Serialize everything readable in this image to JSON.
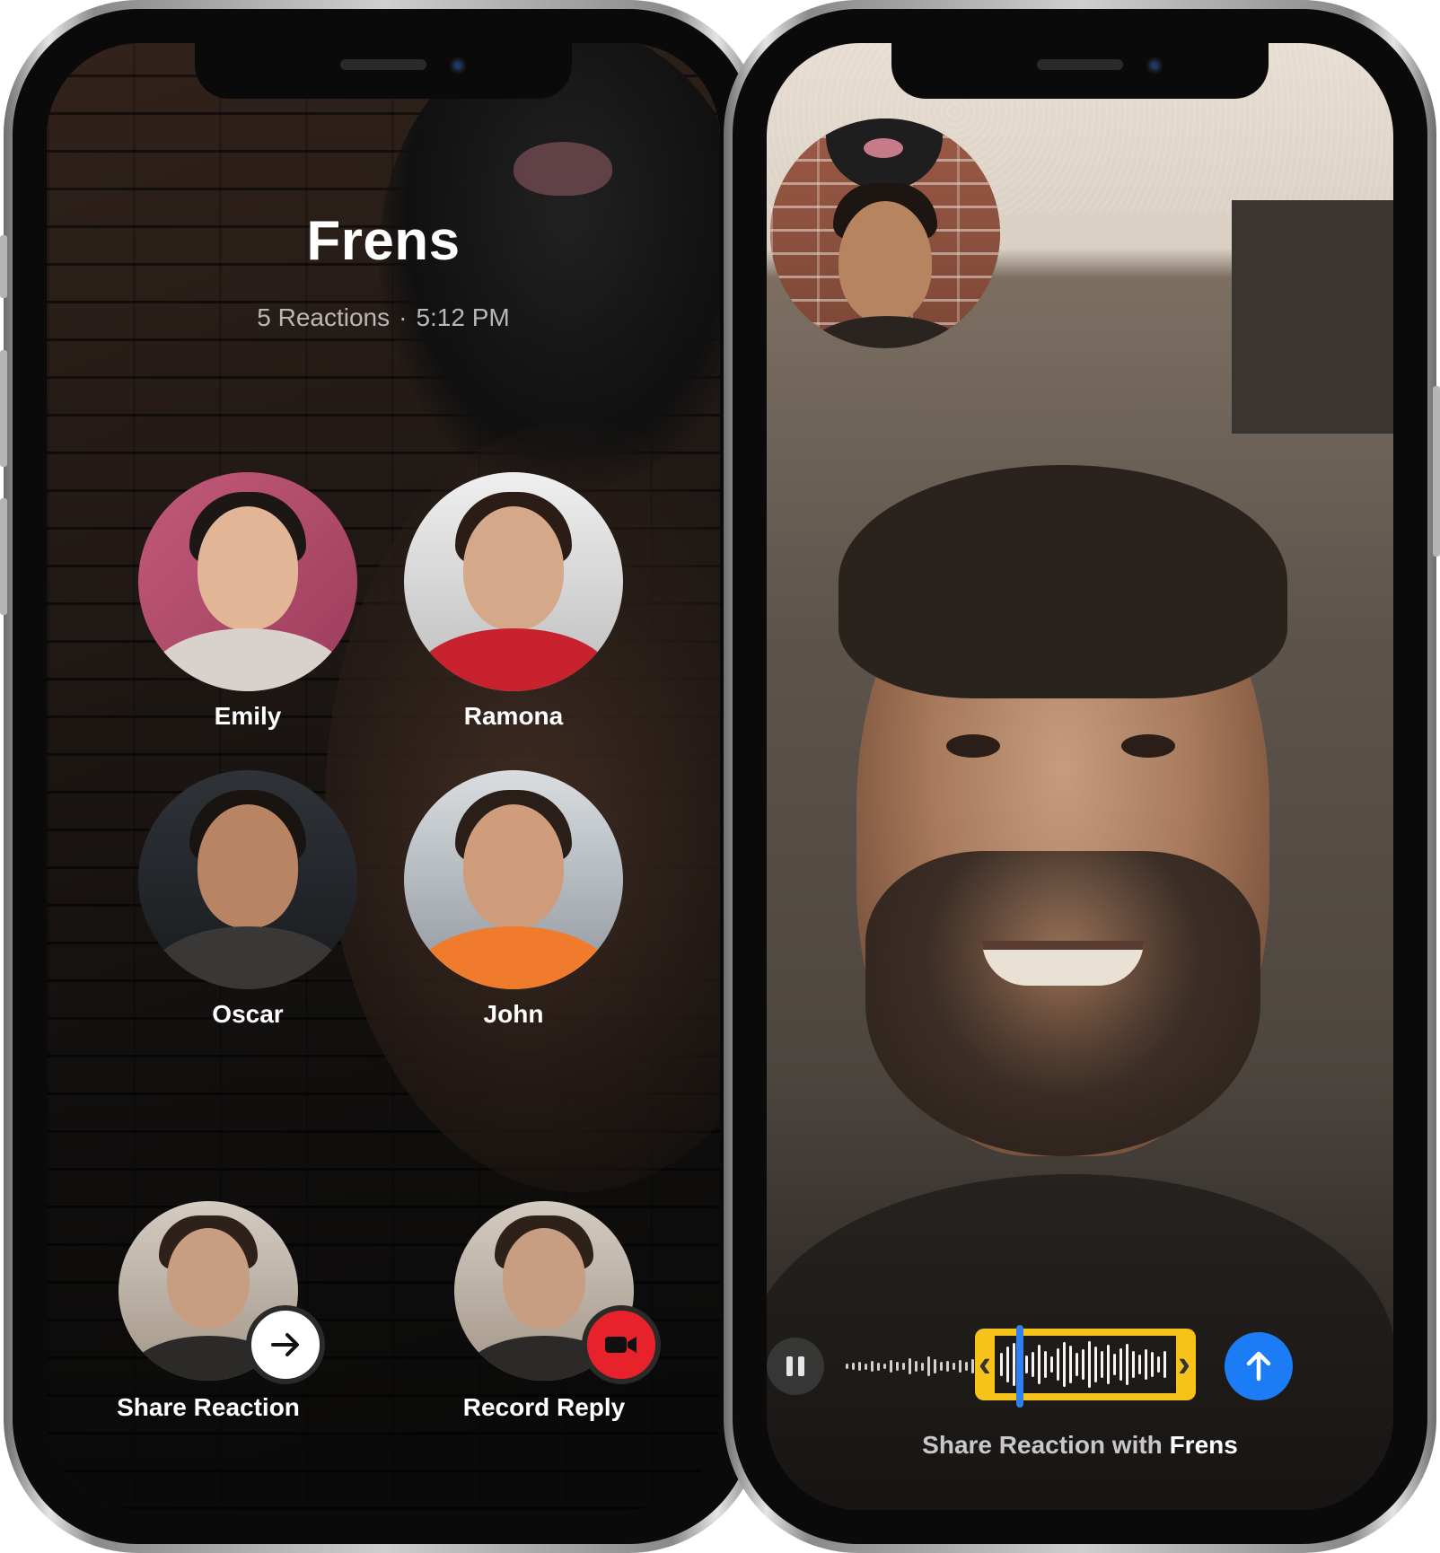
{
  "left_screen": {
    "group_title": "Frens",
    "reactions_count": "5 Reactions",
    "separator": "·",
    "time": "5:12 PM",
    "people": [
      {
        "name": "Emily"
      },
      {
        "name": "Ramona"
      },
      {
        "name": "Oscar"
      },
      {
        "name": "John"
      }
    ],
    "actions": {
      "share_label": "Share Reaction",
      "record_label": "Record Reply"
    }
  },
  "right_screen": {
    "caption_prefix": "Share Reaction with ",
    "caption_group": "Frens",
    "icons": {
      "pause": "pause-icon",
      "send": "arrow-up-icon",
      "share": "arrow-right-icon",
      "record": "video-camera-icon"
    }
  },
  "colors": {
    "trim_accent": "#f7c31b",
    "send_button": "#1b7cf5",
    "record_button": "#e8222b",
    "playhead": "#2f7ff0"
  }
}
